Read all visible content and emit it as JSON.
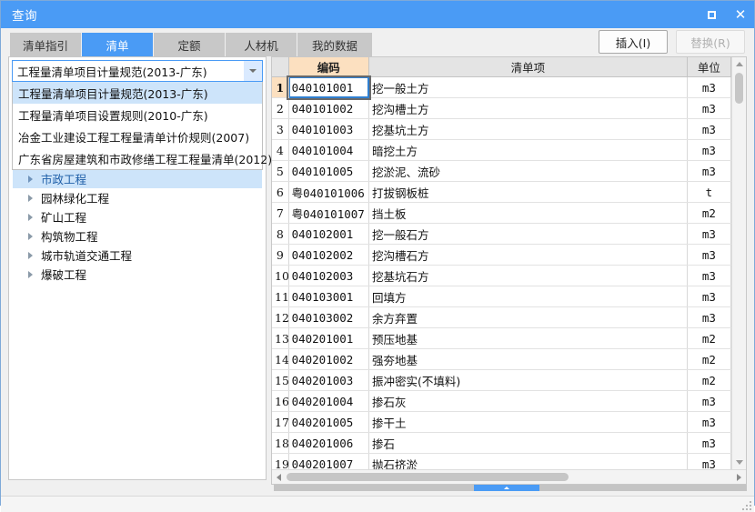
{
  "window": {
    "title": "查询",
    "controls": {
      "maximize": "maximize-icon",
      "close": "close-icon"
    },
    "accent_color": "#4a9bf5"
  },
  "tabs": [
    {
      "label": "清单指引",
      "active": false
    },
    {
      "label": "清单",
      "active": true
    },
    {
      "label": "定额",
      "active": false
    },
    {
      "label": "人材机",
      "active": false
    },
    {
      "label": "我的数据",
      "active": false
    }
  ],
  "toolbar": {
    "insert_label": "插入(I)",
    "replace_label": "替换(R)",
    "replace_disabled": true
  },
  "left_panel": {
    "combo": {
      "value": "工程量清单项目计量规范(2013-广东)",
      "arrow_icon": "chevron-down-icon",
      "expanded": true,
      "options": [
        "工程量清单项目计量规范(2013-广东)",
        "工程量清单项目设置规则(2010-广东)",
        "冶金工业建设工程工程量清单计价规则(2007)",
        "广东省房屋建筑和市政修缮工程工程量清单(2012)"
      ],
      "selected_index": 0
    },
    "tree": {
      "items": [
        {
          "label": "市政工程",
          "selected": true
        },
        {
          "label": "园林绿化工程",
          "selected": false
        },
        {
          "label": "矿山工程",
          "selected": false
        },
        {
          "label": "构筑物工程",
          "selected": false
        },
        {
          "label": "城市轨道交通工程",
          "selected": false
        },
        {
          "label": "爆破工程",
          "selected": false
        }
      ],
      "expander_icon": "triangle-right-icon"
    }
  },
  "grid": {
    "columns": [
      "",
      "编码",
      "清单项",
      "单位"
    ],
    "active_row_index": 0,
    "rows": [
      {
        "n": "1",
        "code": "040101001",
        "name": "挖一般土方",
        "unit": "m3"
      },
      {
        "n": "2",
        "code": "040101002",
        "name": "挖沟槽土方",
        "unit": "m3"
      },
      {
        "n": "3",
        "code": "040101003",
        "name": "挖基坑土方",
        "unit": "m3"
      },
      {
        "n": "4",
        "code": "040101004",
        "name": "暗挖土方",
        "unit": "m3"
      },
      {
        "n": "5",
        "code": "040101005",
        "name": "挖淤泥、流砂",
        "unit": "m3"
      },
      {
        "n": "6",
        "code": "粤040101006",
        "name": "打拔钢板桩",
        "unit": "t"
      },
      {
        "n": "7",
        "code": "粤040101007",
        "name": "挡土板",
        "unit": "m2"
      },
      {
        "n": "8",
        "code": "040102001",
        "name": "挖一般石方",
        "unit": "m3"
      },
      {
        "n": "9",
        "code": "040102002",
        "name": "挖沟槽石方",
        "unit": "m3"
      },
      {
        "n": "10",
        "code": "040102003",
        "name": "挖基坑石方",
        "unit": "m3"
      },
      {
        "n": "11",
        "code": "040103001",
        "name": "回填方",
        "unit": "m3"
      },
      {
        "n": "12",
        "code": "040103002",
        "name": "余方弃置",
        "unit": "m3"
      },
      {
        "n": "13",
        "code": "040201001",
        "name": "预压地基",
        "unit": "m2"
      },
      {
        "n": "14",
        "code": "040201002",
        "name": "强夯地基",
        "unit": "m2"
      },
      {
        "n": "15",
        "code": "040201003",
        "name": "振冲密实(不填料)",
        "unit": "m2"
      },
      {
        "n": "16",
        "code": "040201004",
        "name": "掺石灰",
        "unit": "m3"
      },
      {
        "n": "17",
        "code": "040201005",
        "name": "掺干土",
        "unit": "m3"
      },
      {
        "n": "18",
        "code": "040201006",
        "name": "掺石",
        "unit": "m3"
      },
      {
        "n": "19",
        "code": "040201007",
        "name": "抛石挤淤",
        "unit": "m3"
      }
    ]
  },
  "scrollbars": {
    "vertical": {
      "up_icon": "triangle-up-icon",
      "down_icon": "triangle-down-icon"
    },
    "horizontal": {
      "left_icon": "triangle-left-icon",
      "right_icon": "triangle-right-icon"
    }
  },
  "splitter": {
    "handle_icon": "collapse-up-icon"
  }
}
